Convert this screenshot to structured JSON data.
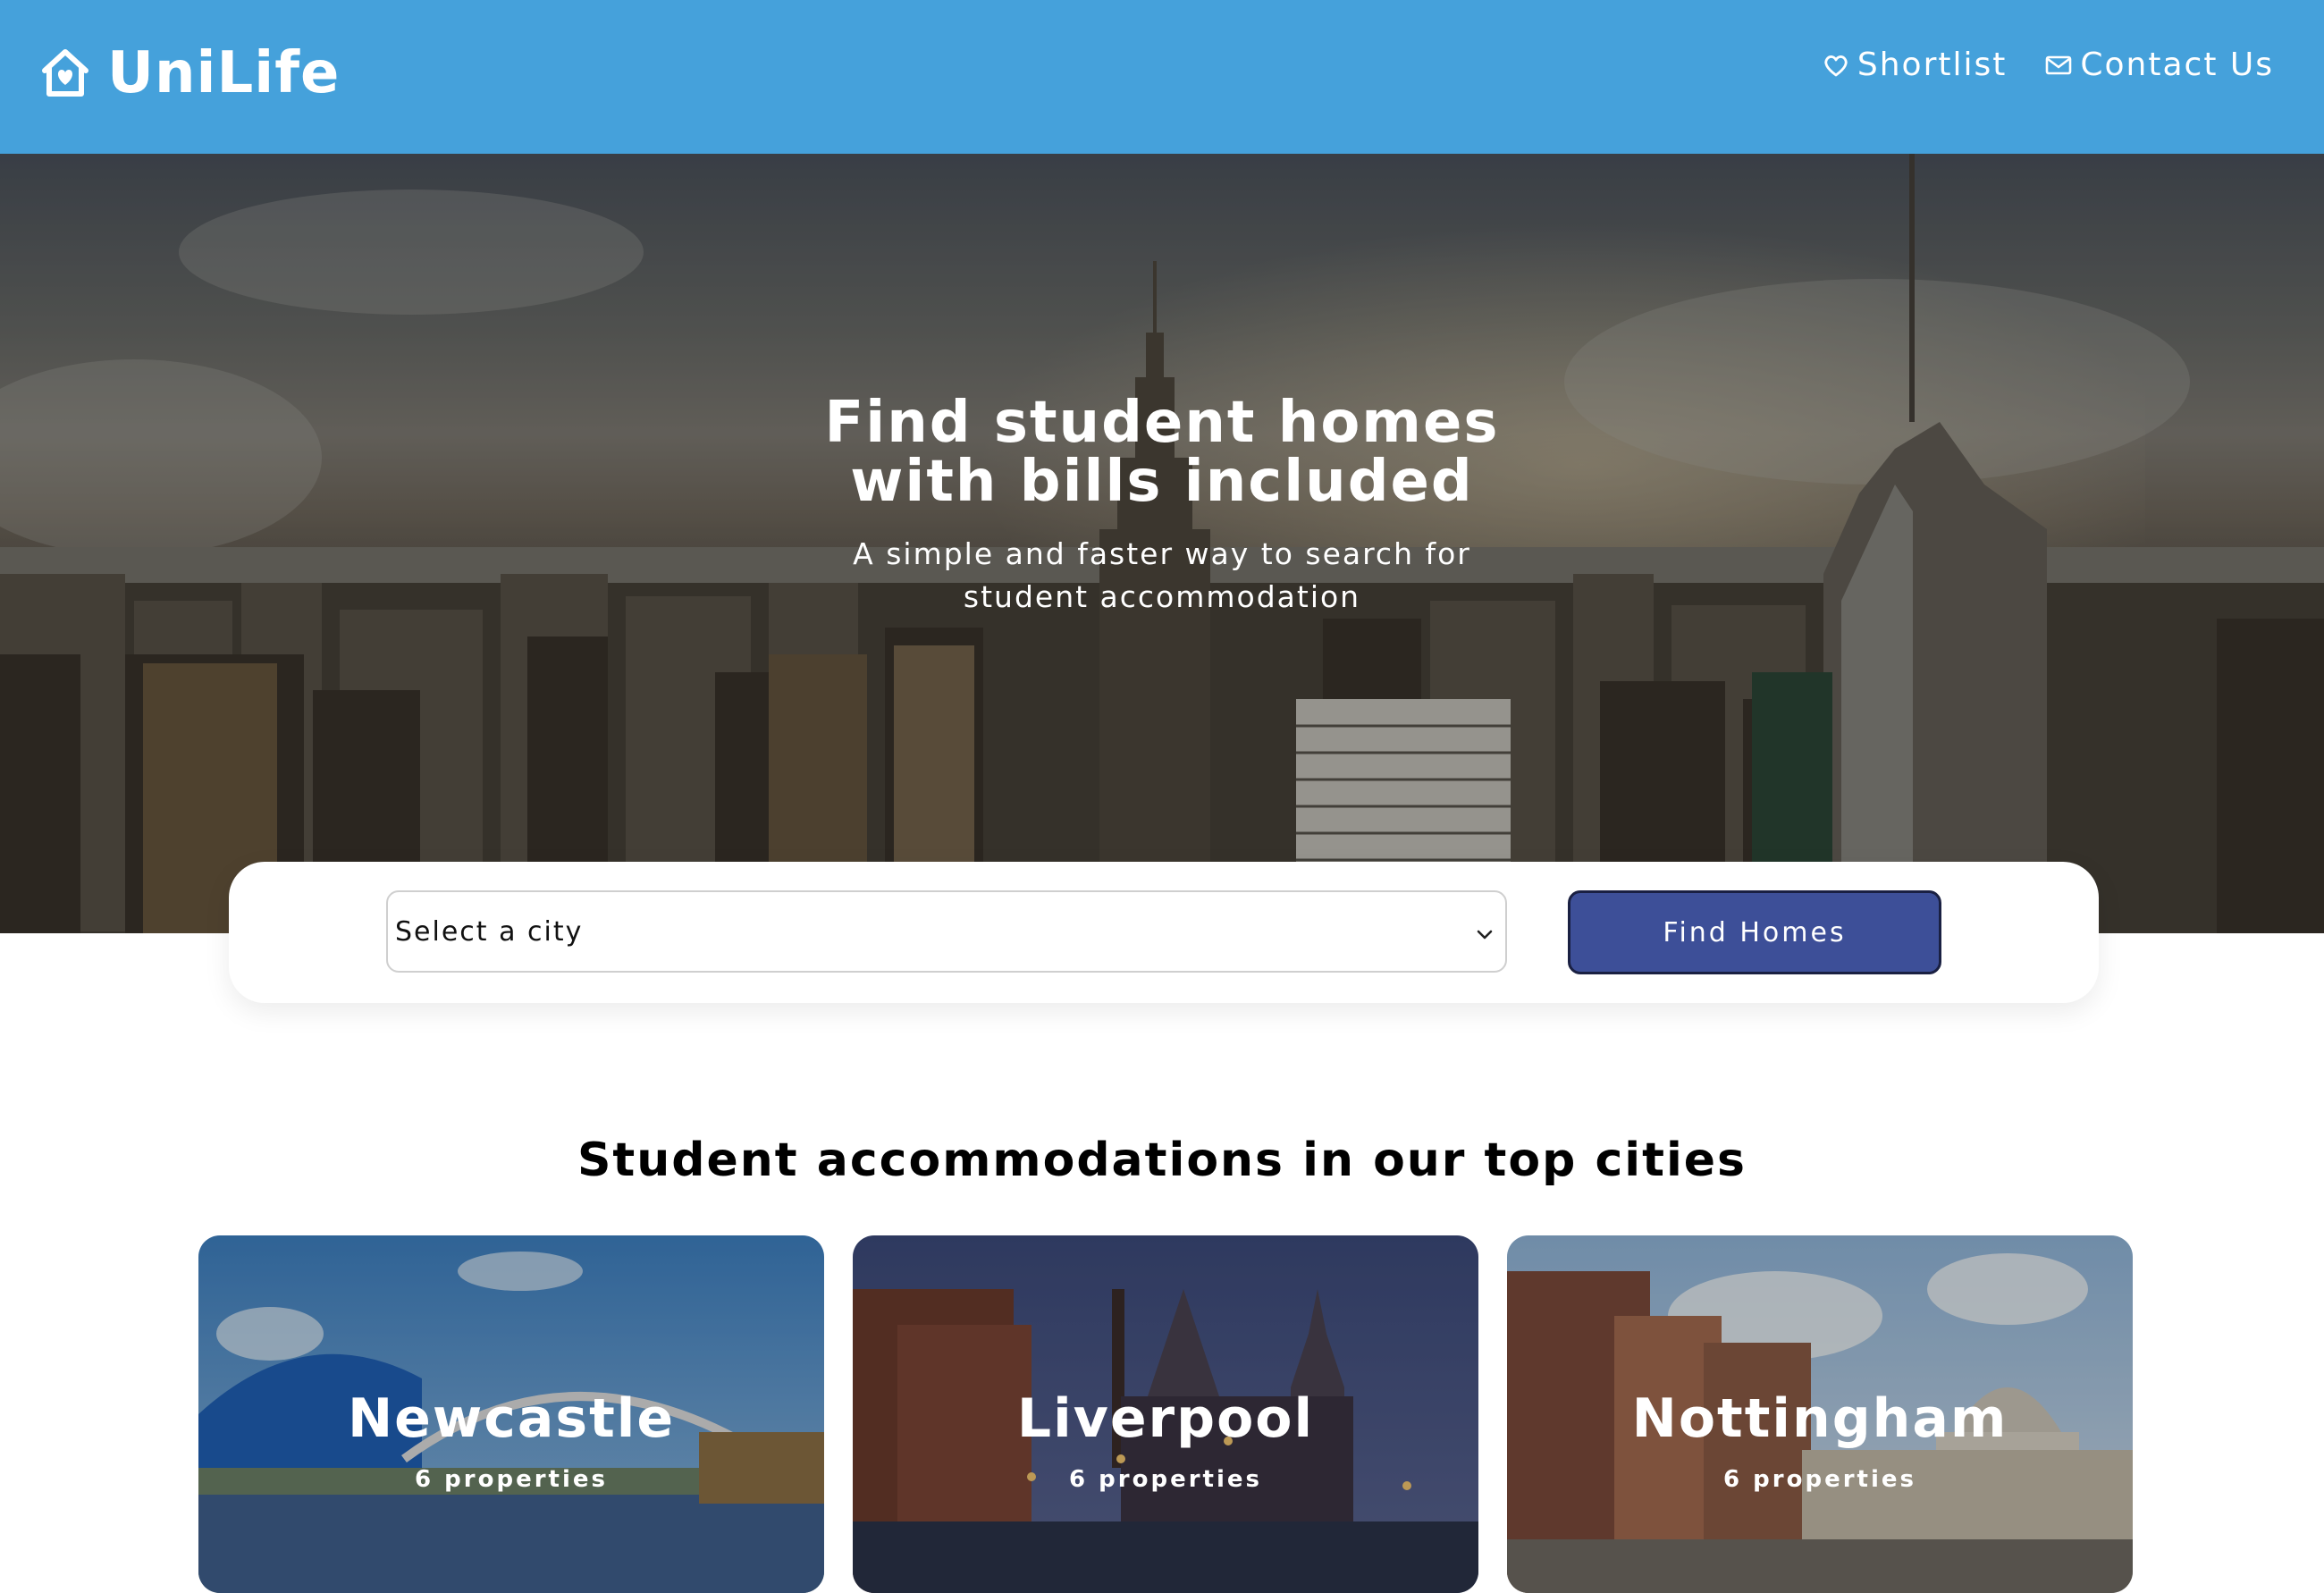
{
  "header": {
    "logo_text": "UniLife",
    "nav": [
      {
        "label": "Shortlist",
        "icon": "heart-icon"
      },
      {
        "label": "Contact Us",
        "icon": "mail-icon"
      }
    ],
    "background_color": "#45a1db"
  },
  "hero": {
    "title_line1": "Find student homes",
    "title_line2": "with bills included",
    "subtitle": "A simple and faster way to search for student accommodation"
  },
  "search": {
    "select_value": "Select a city",
    "button_label": "Find Homes",
    "button_color": "#3d4f98"
  },
  "top_cities": {
    "title": "Student accommodations in our top cities",
    "cities": [
      {
        "name": "Newcastle",
        "count": "6 properties"
      },
      {
        "name": "Liverpool",
        "count": "6 properties"
      },
      {
        "name": "Nottingham",
        "count": "6 properties"
      }
    ]
  }
}
